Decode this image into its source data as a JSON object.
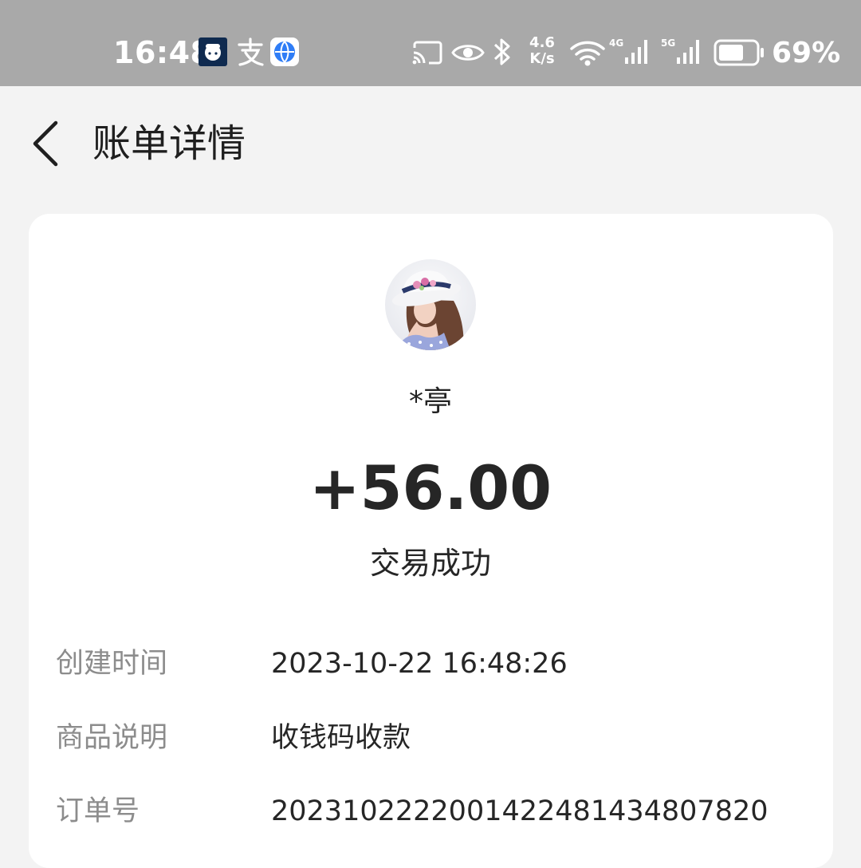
{
  "status_bar": {
    "time": "16:48",
    "net_speed_value": "4.6",
    "net_speed_unit": "K/s",
    "signal_4g_label": "4G",
    "signal_5g_label": "5G",
    "battery_percent": "69%",
    "battery_level": 0.69,
    "icons": [
      "notification-app-icon",
      "alipay-icon",
      "browser-icon",
      "cast-icon",
      "eye-icon",
      "bluetooth-icon",
      "wifi-icon",
      "signal-4g-icon",
      "signal-5g-icon",
      "battery-icon"
    ]
  },
  "header": {
    "title": "账单详情"
  },
  "bill": {
    "payer_name": "*亭",
    "amount": "+56.00",
    "status": "交易成功",
    "details": [
      {
        "label": "创建时间",
        "value": "2023-10-22 16:48:26"
      },
      {
        "label": "商品说明",
        "value": "收钱码收款"
      },
      {
        "label": "订单号",
        "value": "20231022220014224814348078​20"
      }
    ]
  },
  "colors": {
    "status_bar_bg": "#a9a9a9",
    "page_bg": "#f3f3f3",
    "card_bg": "#ffffff",
    "label_gray": "#8c8c8c",
    "text_dark": "#262626"
  }
}
